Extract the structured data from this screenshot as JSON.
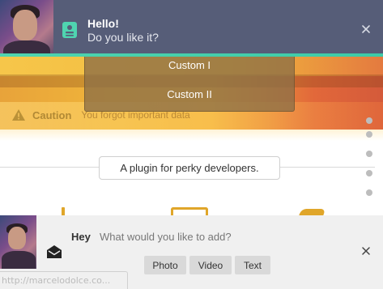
{
  "caution": {
    "title": "Caution",
    "message": "You forgot important data",
    "icon": "warning-icon"
  },
  "dropdown": {
    "items": [
      "Custom I",
      "Custom II"
    ]
  },
  "top_notification": {
    "title": "Hello!",
    "message": "Do you like it?",
    "icon": "contact-card-icon",
    "close_icon": "close-icon",
    "accent_color": "#3ccaa8",
    "background_color": "#565d78"
  },
  "pill": {
    "label": "A plugin for perky developers."
  },
  "bottom_notification": {
    "title": "Hey",
    "message": "What would you like to add?",
    "icon": "envelope-icon",
    "buttons": [
      "Photo",
      "Video",
      "Text"
    ],
    "close_icon": "close-icon"
  },
  "statusbar": {
    "url": "http://marcelodolce.co..."
  },
  "colors": {
    "band": "#f0b53a",
    "icon_accent": "#e0a62a"
  }
}
